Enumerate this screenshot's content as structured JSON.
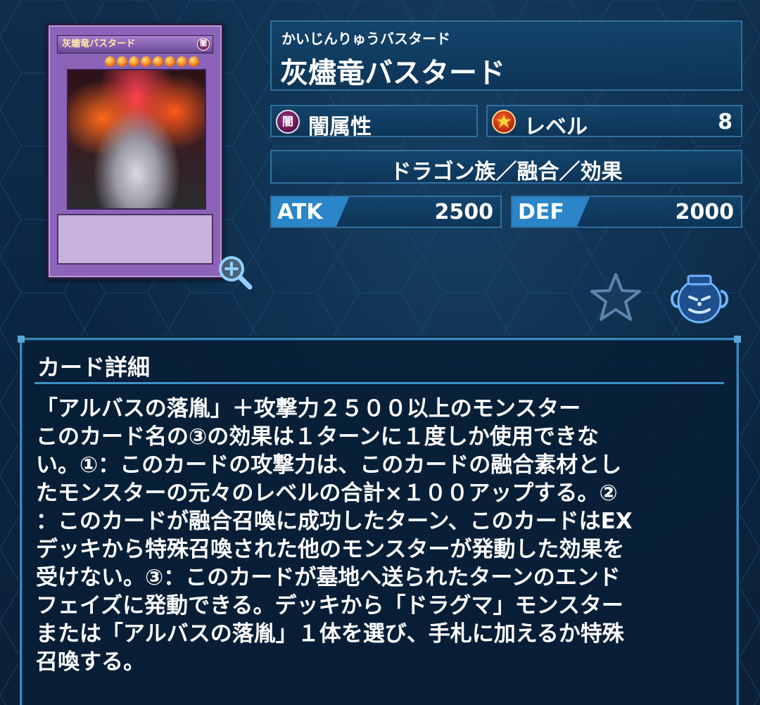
{
  "card": {
    "thumbnail_name": "灰燼竜バスタード",
    "thumbnail_attribute": "闇",
    "level_stars": 8
  },
  "name": {
    "reading": "かいじんりゅうバスタード",
    "main": "灰燼竜バスタード"
  },
  "attribute": {
    "icon_glyph": "闇",
    "label": "闇属性"
  },
  "level": {
    "label": "レベル",
    "value": "8"
  },
  "type_line": "ドラゴン族／融合／効果",
  "stats": {
    "atk_label": "ATK",
    "atk_value": "2500",
    "def_label": "DEF",
    "def_value": "2000"
  },
  "details": {
    "title": "カード詳細",
    "text": "「アルバスの落胤」＋攻撃力２５００以上のモンスター\nこのカード名の③の効果は１ターンに１度しか使用できな\nい。①：このカードの攻撃力は、このカードの融合素材とし\nたモンスターの元々のレベルの合計×１００アップする。②\n：このカードが融合召喚に成功したターン、このカードはEX\nデッキから特殊召喚された他のモンスターが発動した効果を\n受けない。③：このカードが墓地へ送られたターンのエンド\nフェイズに発動できる。デッキから「ドラグマ」モンスター\nまたは「アルバスの落胤」１体を選び、手札に加えるか特殊\n召喚する。"
  },
  "colors": {
    "background": "#0b2540",
    "panel": "#14466e",
    "panel_border": "#2f6f9e",
    "stat_tag": "#2a86c8",
    "card_frame": "#8b63b8"
  },
  "icons": {
    "zoom": "zoom-in-icon",
    "favorite": "star-icon",
    "pot": "pot-of-greed-icon",
    "attribute": "dark-attribute-icon",
    "level": "level-star-icon"
  }
}
